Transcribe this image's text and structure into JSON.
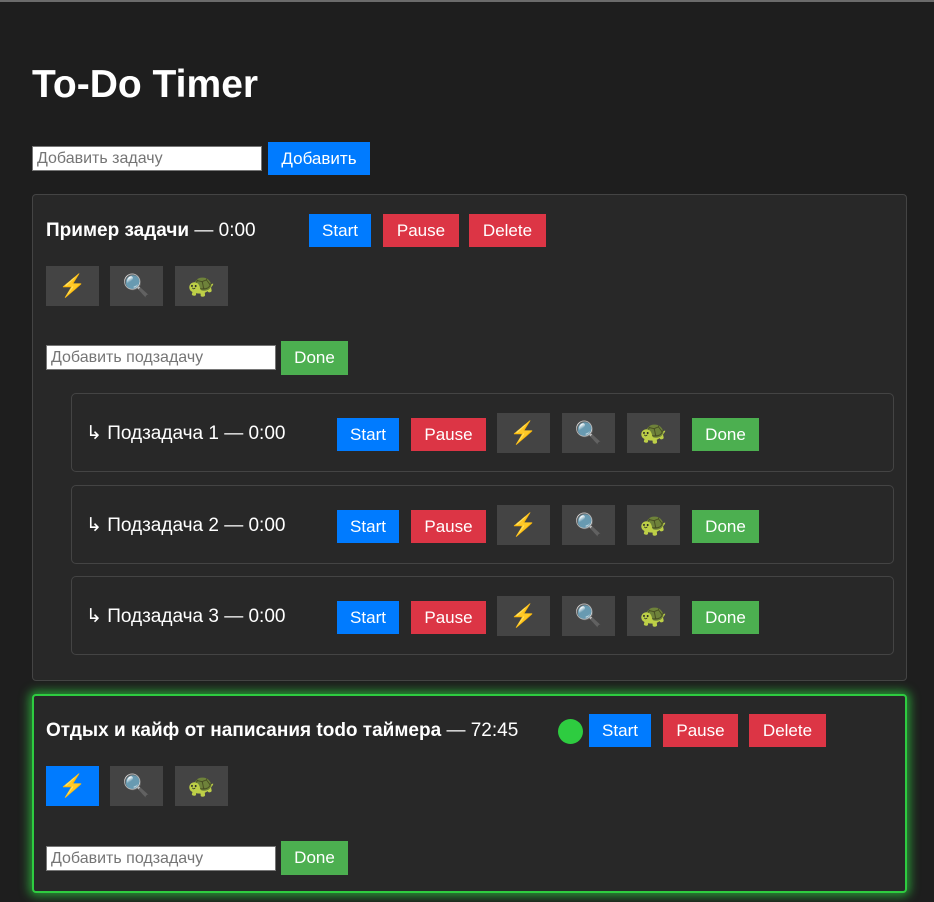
{
  "app": {
    "title": "To-Do Timer"
  },
  "new_task": {
    "placeholder": "Добавить задачу",
    "add_label": "Добавить"
  },
  "icons": {
    "lightning": "⚡",
    "magnifier": "🔍",
    "turtle": "🐢"
  },
  "tasks": [
    {
      "name": "Пример задачи",
      "separator": "—",
      "time": "0:00",
      "start_label": "Start",
      "pause_label": "Pause",
      "delete_label": "Delete",
      "active_mode": "none",
      "running": false,
      "subtask_placeholder": "Добавить подзадачу",
      "subtask_done_label": "Done",
      "subtasks": [
        {
          "label": "↳ Подзадача 1 — 0:00",
          "start_label": "Start",
          "pause_label": "Pause",
          "done_label": "Done"
        },
        {
          "label": "↳ Подзадача 2 — 0:00",
          "start_label": "Start",
          "pause_label": "Pause",
          "done_label": "Done"
        },
        {
          "label": "↳ Подзадача 3 — 0:00",
          "start_label": "Start",
          "pause_label": "Pause",
          "done_label": "Done"
        }
      ]
    },
    {
      "name": "Отдых и кайф от написания todo таймера",
      "separator": "—",
      "time": "72:45",
      "start_label": "Start",
      "pause_label": "Pause",
      "delete_label": "Delete",
      "active_mode": "lightning",
      "running": true,
      "subtask_placeholder": "Добавить подзадачу",
      "subtask_done_label": "Done",
      "subtasks": []
    }
  ],
  "colors": {
    "background": "#1e1e1e",
    "card": "#282828",
    "blue": "#007bff",
    "red": "#dc3545",
    "green": "#4caf50",
    "running_glow": "#2ecc40"
  }
}
